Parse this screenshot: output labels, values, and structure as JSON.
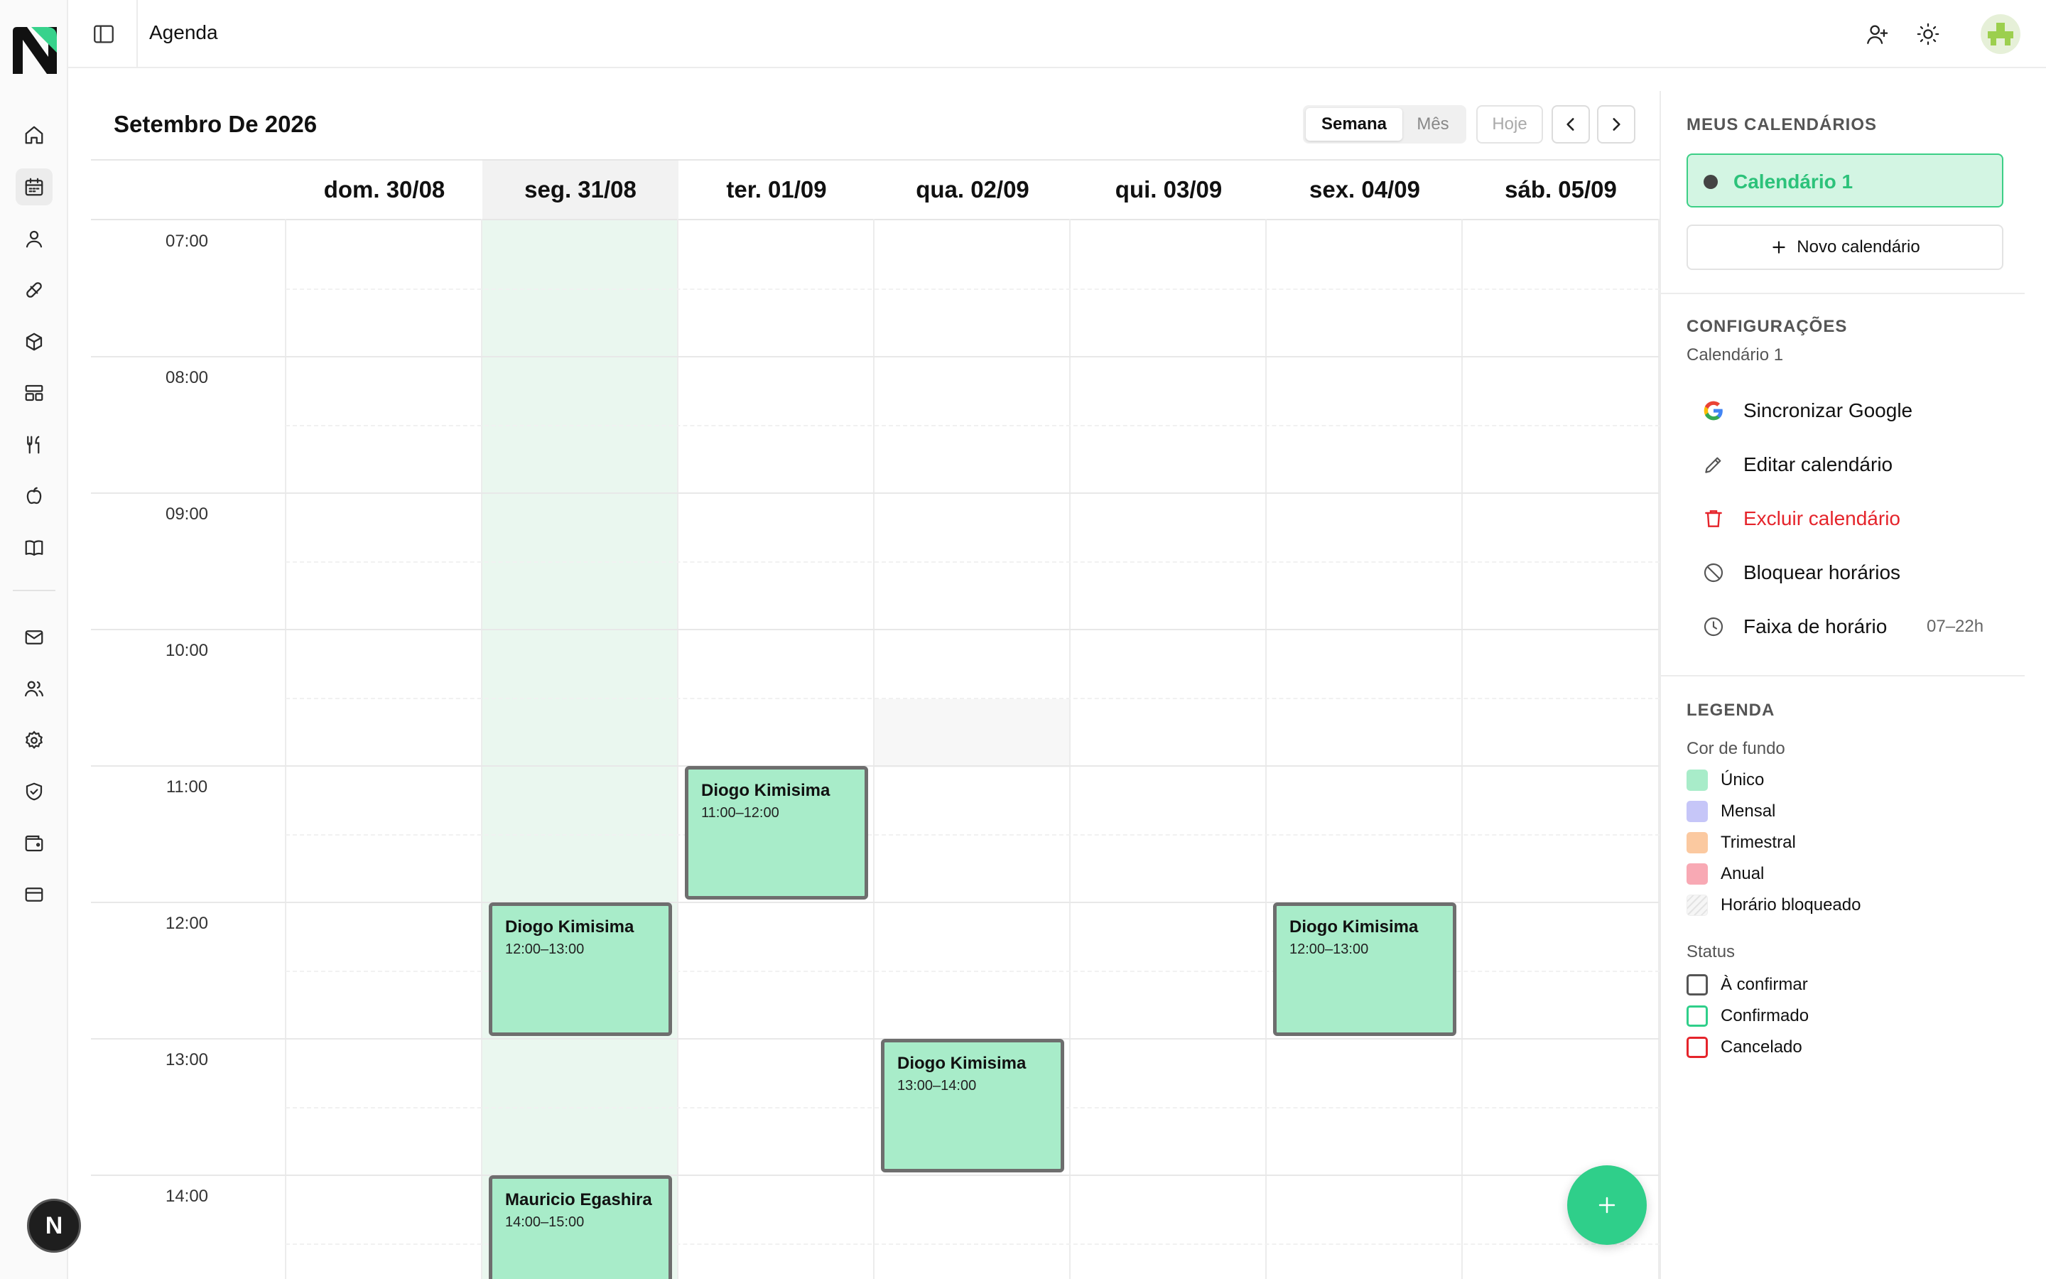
{
  "app": {
    "page_title": "Agenda",
    "avatar_initial": "N"
  },
  "calendar": {
    "month_title": "Setembro De 2026",
    "view_week": "Semana",
    "view_month": "Mês",
    "today_button": "Hoje",
    "days": [
      "dom. 30/08",
      "seg. 31/08",
      "ter. 01/09",
      "qua. 02/09",
      "qui. 03/09",
      "sex. 04/09",
      "sáb. 05/09"
    ],
    "today_index": 1,
    "hours": [
      "07:00",
      "08:00",
      "09:00",
      "10:00",
      "11:00",
      "12:00",
      "13:00",
      "14:00"
    ],
    "events": [
      {
        "name": "Diogo Kimisima",
        "time": "11:00–12:00"
      },
      {
        "name": "Diogo Kimisima",
        "time": "12:00–13:00"
      },
      {
        "name": "Diogo Kimisima",
        "time": "12:00–13:00"
      },
      {
        "name": "Diogo Kimisima",
        "time": "13:00–14:00"
      },
      {
        "name": "Mauricio Egashira",
        "time": "14:00–15:00"
      }
    ],
    "event_color": "#a8ecc9"
  },
  "panel": {
    "my_calendars_title": "MEUS CALENDÁRIOS",
    "calendar_name": "Calendário 1",
    "new_calendar": "Novo calendário",
    "settings_title": "CONFIGURAÇÕES",
    "settings_sub": "Calendário 1",
    "options": {
      "sync_google": "Sincronizar Google",
      "edit": "Editar calendário",
      "delete": "Excluir calendário",
      "block": "Bloquear horários",
      "range": "Faixa de horário",
      "range_value": "07–22h"
    },
    "legend_title": "LEGENDA",
    "bg_title": "Cor de fundo",
    "bg_items": [
      {
        "label": "Único",
        "color": "#a8ecc9"
      },
      {
        "label": "Mensal",
        "color": "#c6c6f8"
      },
      {
        "label": "Trimestral",
        "color": "#fbc9a0"
      },
      {
        "label": "Anual",
        "color": "#f8a9b4"
      },
      {
        "label": "Horário bloqueado",
        "color": "#f3f3f3"
      }
    ],
    "status_title": "Status",
    "status_items": [
      {
        "label": "À confirmar",
        "color": "#555555"
      },
      {
        "label": "Confirmado",
        "color": "#2fcf8a"
      },
      {
        "label": "Cancelado",
        "color": "#e5242b"
      }
    ]
  }
}
